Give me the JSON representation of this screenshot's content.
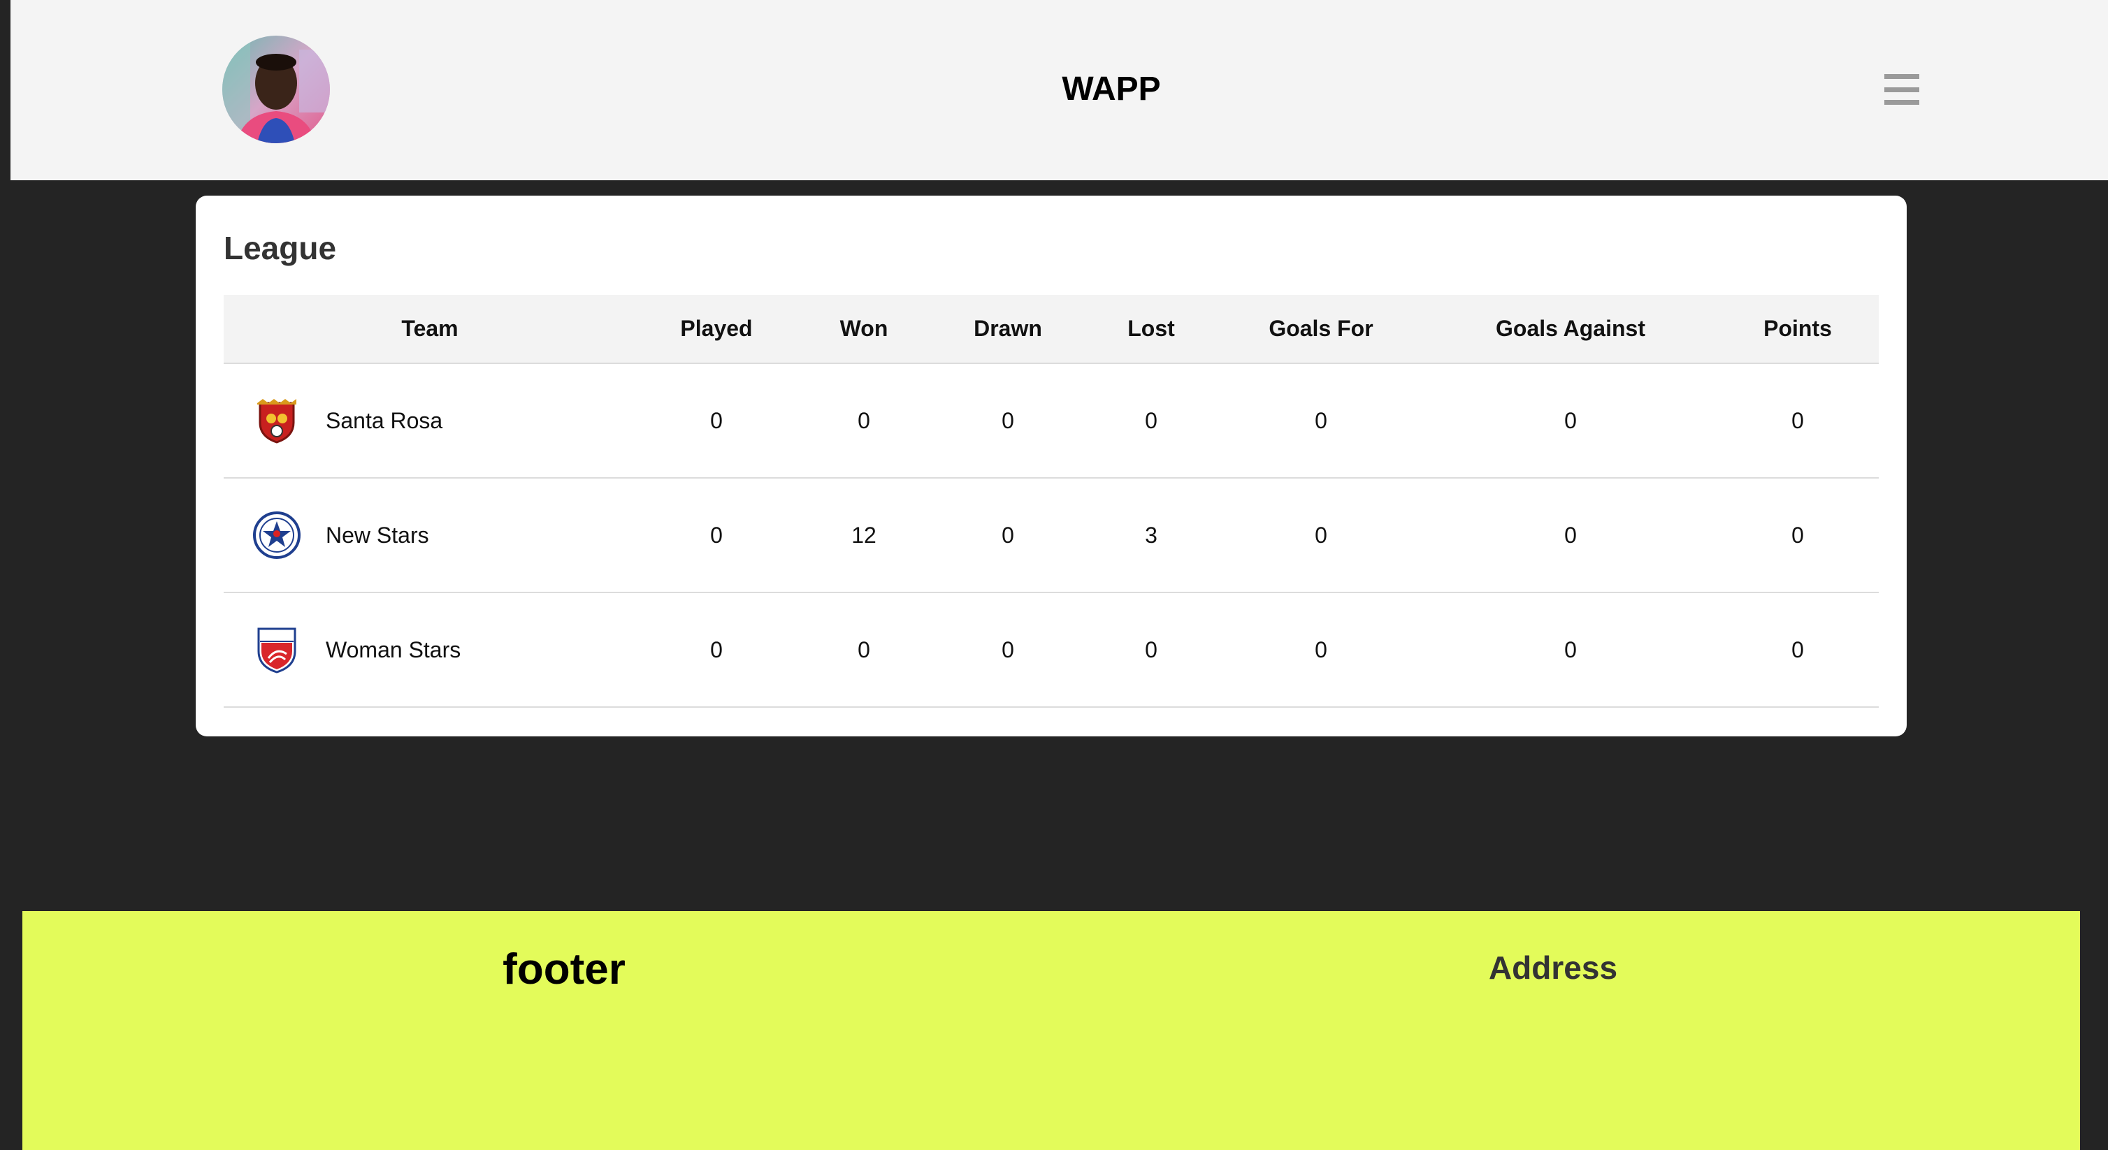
{
  "header": {
    "app_title": "WAPP",
    "avatar_icon": "user-avatar",
    "menu_icon": "hamburger-menu-icon"
  },
  "league": {
    "title": "League",
    "columns": [
      "Team",
      "Played",
      "Won",
      "Drawn",
      "Lost",
      "Goals For",
      "Goals Against",
      "Points"
    ],
    "rows": [
      {
        "team": "Santa Rosa",
        "logo": "santa-rosa-crest-icon",
        "played": "0",
        "won": "0",
        "drawn": "0",
        "lost": "0",
        "goals_for": "0",
        "goals_against": "0",
        "points": "0"
      },
      {
        "team": "New Stars",
        "logo": "new-stars-crest-icon",
        "played": "0",
        "won": "12",
        "drawn": "0",
        "lost": "3",
        "goals_for": "0",
        "goals_against": "0",
        "points": "0"
      },
      {
        "team": "Woman Stars",
        "logo": "woman-stars-crest-icon",
        "played": "0",
        "won": "0",
        "drawn": "0",
        "lost": "0",
        "goals_for": "0",
        "goals_against": "0",
        "points": "0"
      }
    ]
  },
  "footer": {
    "title": "footer",
    "address_label": "Address"
  },
  "colors": {
    "background": "#242424",
    "header_bg": "#f4f4f4",
    "footer_bg": "#e3fb5a"
  }
}
